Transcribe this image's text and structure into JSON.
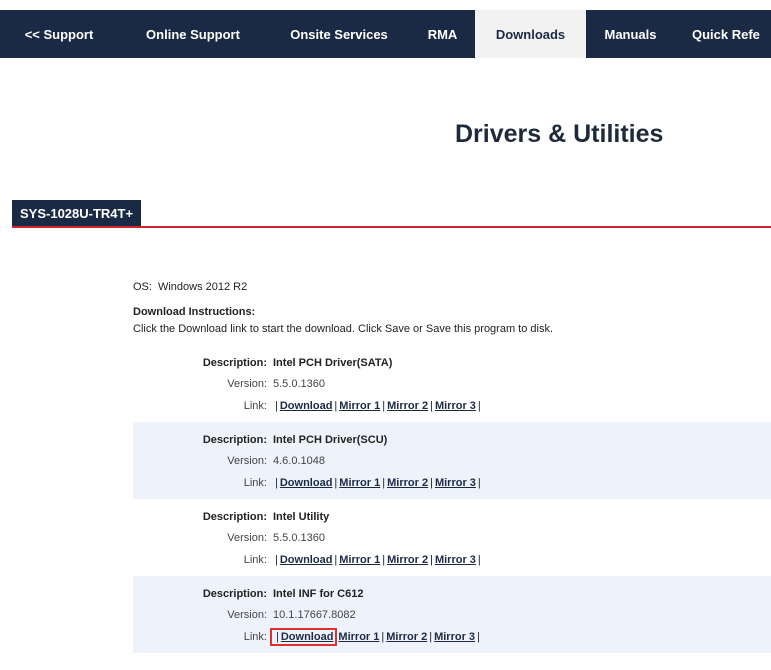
{
  "nav": {
    "items": [
      {
        "label": "<< Support",
        "active": false
      },
      {
        "label": "Online Support",
        "active": false
      },
      {
        "label": "Onsite Services",
        "active": false
      },
      {
        "label": "RMA",
        "active": false
      },
      {
        "label": "Downloads",
        "active": true
      },
      {
        "label": "Manuals",
        "active": false
      },
      {
        "label": "Quick Refe",
        "active": false
      }
    ]
  },
  "page": {
    "title": "Drivers & Utilities"
  },
  "model": {
    "tab_label": "SYS-1028U-TR4T+"
  },
  "os": {
    "label": "OS:",
    "value": "Windows 2012 R2"
  },
  "instructions": {
    "heading": "Download Instructions:",
    "text": "Click the Download link to start the download. Click Save or Save this program to disk."
  },
  "labels": {
    "description": "Description:",
    "version": "Version:",
    "link": "Link:"
  },
  "drivers": [
    {
      "description": "Intel PCH Driver(SATA)",
      "version": "5.5.0.1360",
      "links": [
        "Download",
        "Mirror 1",
        "Mirror 2",
        "Mirror 3"
      ]
    },
    {
      "description": "Intel PCH Driver(SCU)",
      "version": "4.6.0.1048",
      "links": [
        "Download",
        "Mirror 1",
        "Mirror 2",
        "Mirror 3"
      ]
    },
    {
      "description": "Intel Utility",
      "version": "5.5.0.1360",
      "links": [
        "Download",
        "Mirror 1",
        "Mirror 2",
        "Mirror 3"
      ]
    },
    {
      "description": "Intel INF for C612",
      "version": "10.1.17667.8082",
      "links": [
        "Download",
        "Mirror 1",
        "Mirror 2",
        "Mirror 3"
      ]
    }
  ],
  "colors": {
    "nav_bg": "#1b2a44",
    "accent_rule": "#d0242f",
    "highlight_box": "#e03030",
    "alt_row": "#eef3fb"
  }
}
